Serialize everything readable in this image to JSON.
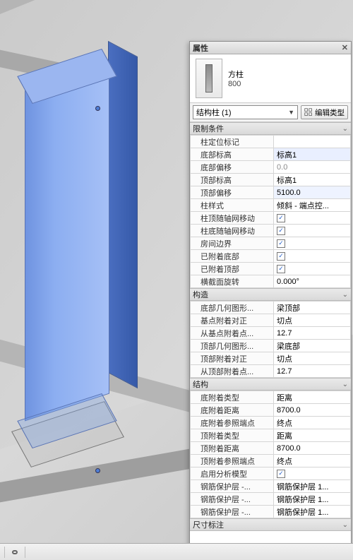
{
  "panel": {
    "title": "属性",
    "type": {
      "family": "方柱",
      "size": "800"
    },
    "instance_selector": "结构柱 (1)",
    "edit_type_label": "编辑类型"
  },
  "groups": [
    {
      "name": "限制条件",
      "rows": [
        {
          "k": "柱定位标记",
          "v": "",
          "readonly": true,
          "indent": true
        },
        {
          "k": "底部标高",
          "v": "标高1",
          "indent": true,
          "selected": true
        },
        {
          "k": "底部偏移",
          "v": "0.0",
          "readonly": true,
          "indent": true
        },
        {
          "k": "顶部标高",
          "v": "标高1",
          "indent": true
        },
        {
          "k": "顶部偏移",
          "v": "5100.0",
          "indent": true,
          "highlight": true
        },
        {
          "k": "柱样式",
          "v": "倾斜 - 端点控...",
          "indent": true
        },
        {
          "k": "柱顶随轴网移动",
          "type": "check",
          "checked": true,
          "indent": true
        },
        {
          "k": "柱底随轴网移动",
          "type": "check",
          "checked": true,
          "indent": true
        },
        {
          "k": "房间边界",
          "type": "check",
          "checked": true,
          "indent": true
        },
        {
          "k": "已附着底部",
          "type": "check",
          "checked": true,
          "readonly": true,
          "indent": true
        },
        {
          "k": "已附着顶部",
          "type": "check",
          "checked": true,
          "readonly": true,
          "indent": true
        },
        {
          "k": "横截面旋转",
          "v": "0.000°",
          "indent": true
        }
      ]
    },
    {
      "name": "构造",
      "rows": [
        {
          "k": "底部几何图形...",
          "v": "梁顶部",
          "indent": true
        },
        {
          "k": "基点附着对正",
          "v": "切点",
          "indent": true
        },
        {
          "k": "从基点附着点...",
          "v": "12.7",
          "indent": true
        },
        {
          "k": "顶部几何图形...",
          "v": "梁底部",
          "indent": true
        },
        {
          "k": "顶部附着对正",
          "v": "切点",
          "indent": true
        },
        {
          "k": "从顶部附着点...",
          "v": "12.7",
          "indent": true
        }
      ]
    },
    {
      "name": "结构",
      "rows": [
        {
          "k": "底附着类型",
          "v": "距离",
          "indent": true
        },
        {
          "k": "底附着距离",
          "v": "8700.0",
          "indent": true
        },
        {
          "k": "底附着参照端点",
          "v": "终点",
          "indent": true
        },
        {
          "k": "顶附着类型",
          "v": "距离",
          "indent": true
        },
        {
          "k": "顶附着距离",
          "v": "8700.0",
          "indent": true
        },
        {
          "k": "顶附着参照端点",
          "v": "终点",
          "indent": true
        },
        {
          "k": "启用分析模型",
          "type": "check",
          "checked": true,
          "indent": true
        },
        {
          "k": "钢筋保护层 -...",
          "v": "钢筋保护层 1...",
          "indent": true
        },
        {
          "k": "钢筋保护层 -...",
          "v": "钢筋保护层 1...",
          "indent": true
        },
        {
          "k": "钢筋保护层 -...",
          "v": "钢筋保护层 1...",
          "indent": true
        }
      ]
    },
    {
      "name": "尺寸标注",
      "rows": []
    }
  ]
}
